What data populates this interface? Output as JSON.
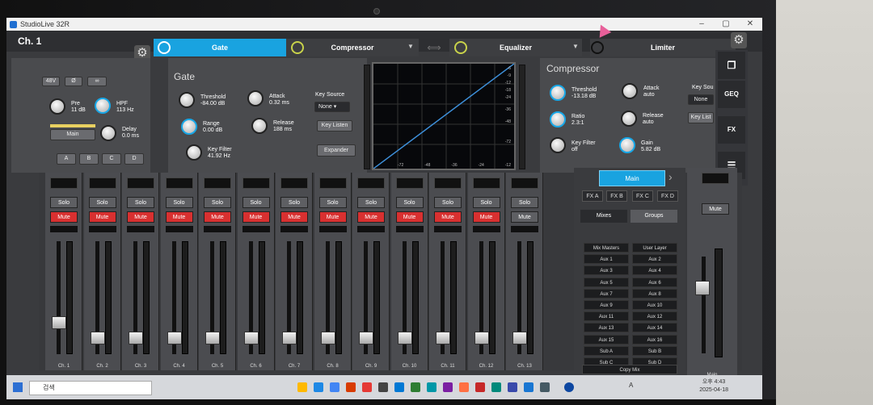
{
  "window": {
    "title": "StudioLive 32R"
  },
  "channel": {
    "name": "Ch. 1"
  },
  "tabs": {
    "gate": "Gate",
    "compressor": "Compressor",
    "equalizer": "Equalizer",
    "limiter": "Limiter"
  },
  "input": {
    "phantom": "48V",
    "polarity": "Ø",
    "link": "∞",
    "pre_label": "Pre",
    "pre_value": "11 dB",
    "hpf_label": "HPF",
    "hpf_value": "113 Hz",
    "delay_label": "Delay",
    "delay_value": "0.0 ms",
    "main_label": "Main",
    "assign": [
      "A",
      "B",
      "C",
      "D"
    ]
  },
  "gate": {
    "title": "Gate",
    "threshold_label": "Threshold",
    "threshold_value": "-84.00 dB",
    "range_label": "Range",
    "range_value": "0.00 dB",
    "key_filter_label": "Key Filter",
    "key_filter_value": "41.92 Hz",
    "attack_label": "Attack",
    "attack_value": "0.32 ms",
    "release_label": "Release",
    "release_value": "188 ms",
    "key_source_label": "Key Source",
    "key_source_value": "None",
    "key_listen": "Key Listen",
    "expander": "Expander"
  },
  "graph": {
    "y_ticks": [
      "-6",
      "-9",
      "-12",
      "-18",
      "-24",
      "-36",
      "-48",
      "-72"
    ],
    "x_ticks": [
      "-72",
      "-48",
      "-36",
      "-24",
      "-12"
    ]
  },
  "compressor": {
    "title": "Compressor",
    "threshold_label": "Threshold",
    "threshold_value": "-13.18 dB",
    "ratio_label": "Ratio",
    "ratio_value": "2.3:1",
    "key_filter_label": "Key Filter",
    "key_filter_value": "off",
    "attack_label": "Attack",
    "attack_value": "auto",
    "release_label": "Release",
    "release_value": "auto",
    "gain_label": "Gain",
    "gain_value": "5.82 dB",
    "key_source_label": "Key Sou",
    "key_source_value": "None",
    "key_listen": "Key List"
  },
  "sidenav": {
    "geq": "GEQ",
    "fx": "FX"
  },
  "strips": {
    "solo": "Solo",
    "mute": "Mute",
    "names": [
      "Ch. 1",
      "Ch. 2",
      "Ch. 3",
      "Ch. 4",
      "Ch. 5",
      "Ch. 6",
      "Ch. 7",
      "Ch. 8",
      "Ch. 9",
      "Ch. 10",
      "Ch. 11",
      "Ch. 12",
      "Ch. 13"
    ],
    "mute_active": [
      true,
      true,
      true,
      true,
      true,
      true,
      true,
      true,
      true,
      true,
      true,
      true,
      false
    ],
    "fader_level": [
      0.25,
      0.1,
      0.1,
      0.1,
      0.1,
      0.1,
      0.1,
      0.1,
      0.1,
      0.1,
      0.1,
      0.1,
      0.1
    ]
  },
  "mixpanel": {
    "main": "Main",
    "fx": [
      "FX A",
      "FX B",
      "FX C",
      "FX D"
    ],
    "mixes_tab": "Mixes",
    "groups_tab": "Groups",
    "left": [
      "Mix Masters",
      "Aux 1",
      "Aux 3",
      "Aux 5",
      "Aux 7",
      "Aux 9",
      "Aux 11",
      "Aux 13",
      "Aux 15",
      "Sub A",
      "Sub C"
    ],
    "right": [
      "User Layer",
      "Aux 2",
      "Aux 4",
      "Aux 6",
      "Aux 8",
      "Aux 10",
      "Aux 12",
      "Aux 14",
      "Aux 16",
      "Sub B",
      "Sub D"
    ],
    "copy_mix": "Copy Mix"
  },
  "mainstrip": {
    "mute": "Mute",
    "name": "Main"
  },
  "taskbar": {
    "search_placeholder": "검색",
    "time": "오후 4:43",
    "date": "2025-04-18",
    "ime": "A"
  }
}
